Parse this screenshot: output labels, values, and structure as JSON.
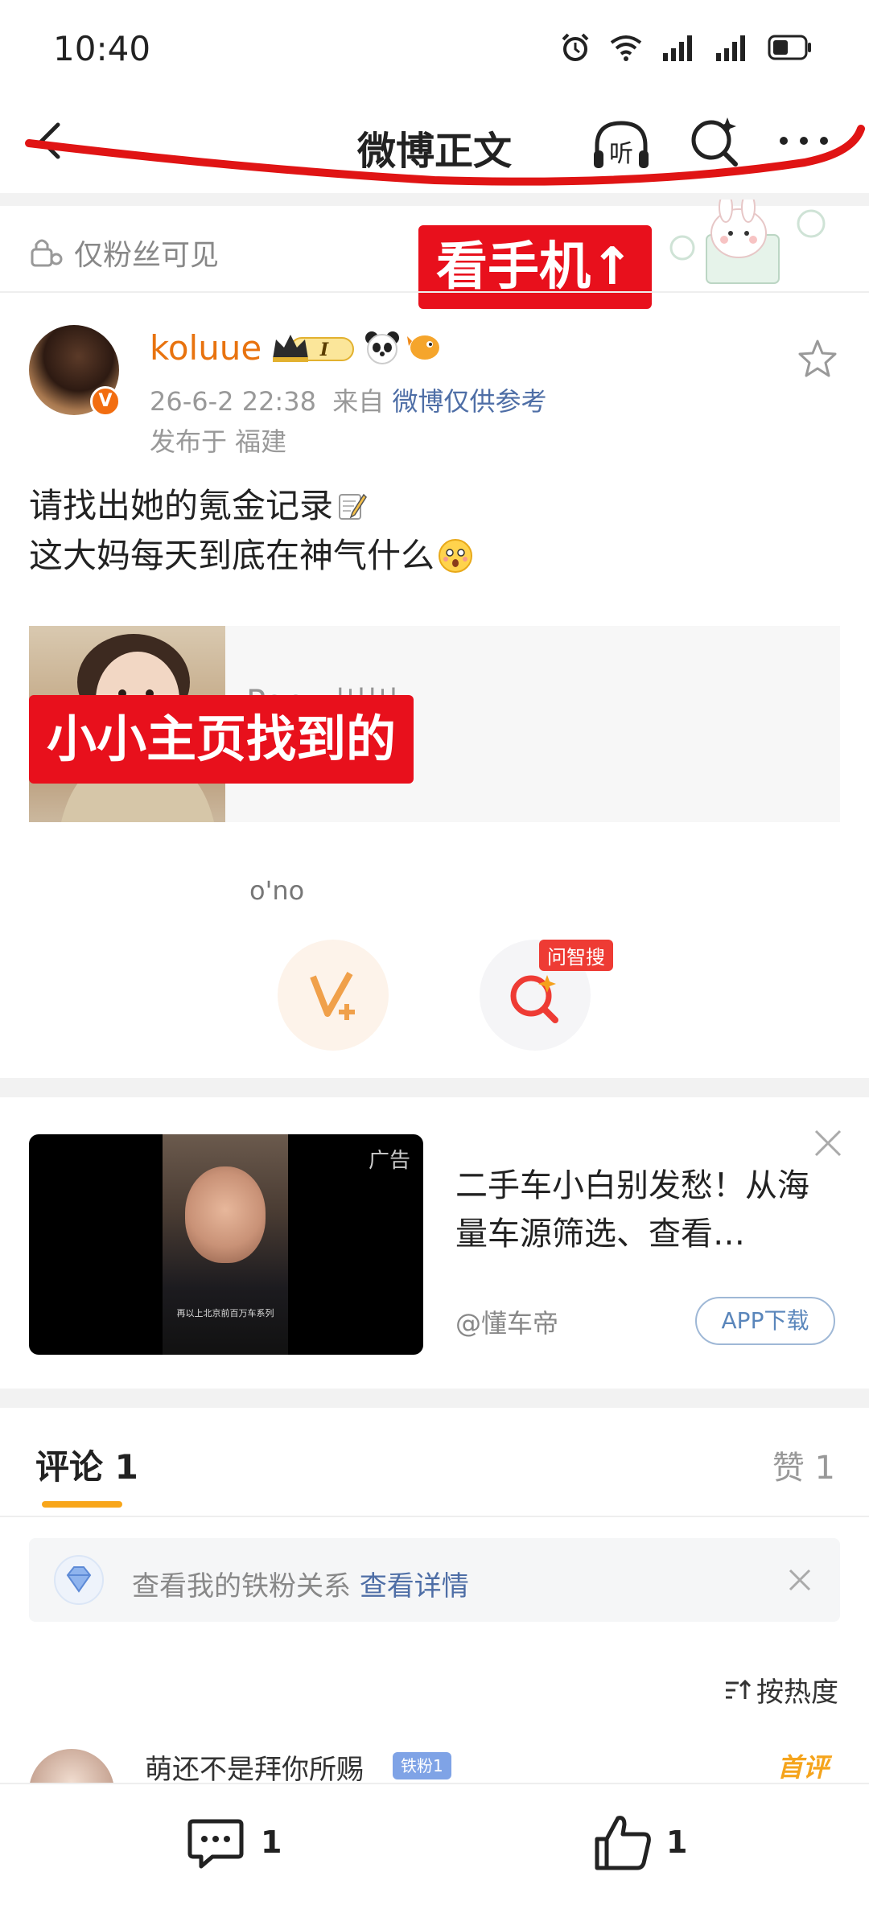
{
  "status_bar": {
    "time": "10:40"
  },
  "nav": {
    "title": "微博正文"
  },
  "post": {
    "visibility": "仅粉丝可见",
    "overlay_top": "看手机↑",
    "username": "koluue",
    "vip_level": "I",
    "date": "26-6-2 22:38",
    "from_prefix": "来自",
    "source": "微博仅供参考",
    "location": "发布于 福建",
    "text_line1": "请找出她的氪金记录",
    "text_line2": "这大妈每天到底在神气什么",
    "card_text": "Pony 川川",
    "overlay_mid": "小小主页找到的",
    "ono": "o'no",
    "ai_badge": "问智搜"
  },
  "ad": {
    "tag": "广告",
    "caption": "再以上北京前百万车系列",
    "title": "二手车小白别发愁！从海量车源筛选、查看…",
    "brand": "@懂车帝",
    "download": "APP下载"
  },
  "comments": {
    "tab_label": "评论 1",
    "likes_label": "赞 1",
    "fan_text": "查看我的铁粉关系",
    "fan_link": "查看详情",
    "sort": "按热度",
    "first": {
      "name": "萌还不是拜你所赐",
      "badge": "铁粉1",
      "tag": "首评"
    }
  },
  "bottom_bar": {
    "comment_count": "1",
    "like_count": "1"
  },
  "colors": {
    "accent_orange": "#e8730f",
    "red_label": "#e8101c",
    "link_blue": "#4e6ea6",
    "underline": "#f8a61a"
  }
}
